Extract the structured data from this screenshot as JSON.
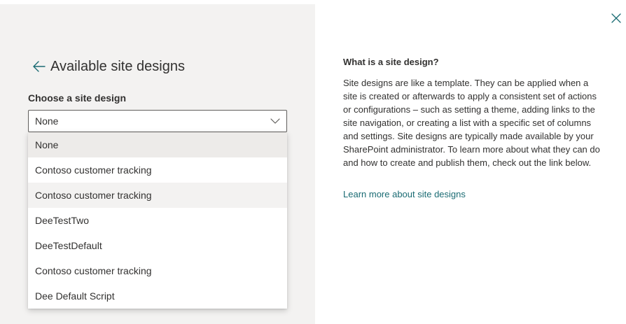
{
  "panel": {
    "title": "Available site designs",
    "field_label": "Choose a site design"
  },
  "dropdown": {
    "selected_value": "None",
    "options": [
      "None",
      "Contoso customer tracking",
      "Contoso customer tracking",
      "DeeTestTwo",
      "DeeTestDefault",
      "Contoso customer tracking",
      "Dee Default Script"
    ]
  },
  "info": {
    "title": "What is a site design?",
    "body": "Site designs are like a template. They can be applied when a site is created or afterwards to apply a consistent set of actions or configurations – such as setting a theme, adding links to the site navigation, or creating a list with a specific set of columns and settings. Site designs are typically made available by your SharePoint administrator. To learn more about what they can do and how to create and publish them, check out the link below.",
    "link_label": "Learn more about site designs"
  },
  "icons": {
    "back": "arrow-left-icon",
    "chevron": "chevron-down-icon",
    "close": "close-icon"
  },
  "colors": {
    "left_panel_bg": "#f3f2f1",
    "accent": "#1a6b73",
    "selected_option_bg": "#edebe9",
    "hover_option_bg": "#f3f2f1"
  }
}
